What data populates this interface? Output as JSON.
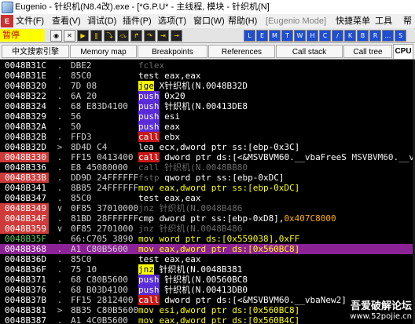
{
  "window": {
    "title": "Eugenio - 针织机(N8.4改).exe - [*G.P.U* - 主线程, 模块 - 针织机(N]"
  },
  "menubar": {
    "items": [
      {
        "label": "文件(F)",
        "enabled": true
      },
      {
        "label": "查看(V)",
        "enabled": true
      },
      {
        "label": "调试(D)",
        "enabled": true
      },
      {
        "label": "插件(P)",
        "enabled": true
      },
      {
        "label": "选项(T)",
        "enabled": true
      },
      {
        "label": "窗口(W)",
        "enabled": true
      },
      {
        "label": "帮助(H)",
        "enabled": true
      },
      {
        "label": "[Eugenio Mode]",
        "enabled": false
      },
      {
        "label": "快捷菜单",
        "enabled": true
      },
      {
        "label": "工具",
        "enabled": true
      },
      {
        "label": "帮",
        "enabled": true
      }
    ]
  },
  "toolbar": {
    "state_label": "暂停",
    "letter_buttons": [
      "L",
      "E",
      "M",
      "T",
      "W",
      "H",
      "C",
      "/",
      "K",
      "B",
      "R",
      "...",
      "S"
    ]
  },
  "tabs": [
    {
      "label": "中文搜索引擎",
      "active": false
    },
    {
      "label": "Memory map",
      "active": false
    },
    {
      "label": "Breakpoints",
      "active": false
    },
    {
      "label": "References",
      "active": false
    },
    {
      "label": "Call stack",
      "active": false
    },
    {
      "label": "Call tree",
      "active": false
    },
    {
      "label": "CPU",
      "active": true
    }
  ],
  "disasm": {
    "rows": [
      {
        "addr": "0048B31C",
        "gut": ".",
        "bytes": "DBE2",
        "ins": [
          {
            "t": "fclex",
            "c": "c-d"
          }
        ]
      },
      {
        "addr": "0048B31E",
        "gut": ".",
        "bytes": "85C0",
        "ins": [
          {
            "t": "test eax,eax",
            "c": "c-w"
          }
        ]
      },
      {
        "addr": "0048B320",
        "gut": ".",
        "bytes": "7D 08",
        "ins": [
          {
            "t": "jge",
            "c": "bg-jmp"
          },
          {
            "t": " X针织机(N.0048B32D",
            "c": "c-w"
          }
        ]
      },
      {
        "addr": "0048B322",
        "gut": ".",
        "bytes": "6A 20",
        "ins": [
          {
            "t": "push",
            "c": "bg-push"
          },
          {
            "t": " 0x20",
            "c": "c-w"
          }
        ]
      },
      {
        "addr": "0048B324",
        "gut": ".",
        "bytes": "68 E83D4100",
        "ins": [
          {
            "t": "push",
            "c": "bg-push"
          },
          {
            "t": " 针织机(N.00413DE8",
            "c": "c-w"
          }
        ]
      },
      {
        "addr": "0048B329",
        "gut": ".",
        "bytes": "56",
        "ins": [
          {
            "t": "push",
            "c": "bg-push"
          },
          {
            "t": " esi",
            "c": "c-w"
          }
        ]
      },
      {
        "addr": "0048B32A",
        "gut": ".",
        "bytes": "50",
        "ins": [
          {
            "t": "push",
            "c": "bg-push"
          },
          {
            "t": " eax",
            "c": "c-w"
          }
        ]
      },
      {
        "addr": "0048B32B",
        "gut": ".",
        "bytes": "FFD3",
        "ins": [
          {
            "t": "call",
            "c": "bg-call"
          },
          {
            "t": " ebx",
            "c": "c-w"
          }
        ]
      },
      {
        "addr": "0048B32D",
        "gut": ">",
        "bytes": "8D4D C4",
        "ins": [
          {
            "t": "lea ecx,dword ptr ss:[ebp-0x3C]",
            "c": "c-w"
          }
        ]
      },
      {
        "addr": "0048B330",
        "gut": ".",
        "bytes": "FF15 0413400",
        "hl": true,
        "ins": [
          {
            "t": "call",
            "c": "bg-call"
          },
          {
            "t": " dword ptr ds:[<&MSVBVM60.__vbaFreeS",
            "c": "c-w"
          },
          {
            "t": "  MSVBVM60.__v",
            "c": "c-m"
          }
        ]
      },
      {
        "addr": "0048B336",
        "gut": ".",
        "bytes": "E8 45080000",
        "ins": [
          {
            "t": "call 针织机(N.0048BB80",
            "c": "c-d"
          }
        ]
      },
      {
        "addr": "0048B33B",
        "gut": ".",
        "bytes": "DD9D 24FFFFFF",
        "hl": true,
        "ins": [
          {
            "t": "fstp",
            "c": "c-d"
          },
          {
            "t": " qword ptr ss:[ebp-0xDC]",
            "c": "c-w"
          }
        ]
      },
      {
        "addr": "0048B341",
        "gut": ".",
        "bytes": "8B85 24FFFFFF",
        "ins": [
          {
            "t": "mov eax,dword ptr ss:[ebp-0xDC]",
            "c": "c-y"
          }
        ]
      },
      {
        "addr": "0048B347",
        "gut": ".",
        "bytes": "85C0",
        "ins": [
          {
            "t": "test eax,eax",
            "c": "c-w"
          }
        ]
      },
      {
        "addr": "0048B349",
        "gut": "∨",
        "bytes": "0F85 37010000",
        "hl": true,
        "ins": [
          {
            "t": "jnz 针织机(N.0048B486",
            "c": "c-d"
          }
        ]
      },
      {
        "addr": "0048B34F",
        "gut": ".",
        "bytes": "81BD 28FFFFFF",
        "hl": true,
        "ins": [
          {
            "t": "cmp dword ptr ss:[ebp-0xD8],",
            "c": "c-w"
          },
          {
            "t": "0x407C8000",
            "c": "c-o"
          }
        ]
      },
      {
        "addr": "0048B359",
        "gut": "∨",
        "bytes": "0F85 2701000",
        "hl": true,
        "ins": [
          {
            "t": "jnz 针织机(N.0048B486",
            "c": "c-d"
          }
        ]
      },
      {
        "addr": "0048B35F",
        "gut": ".",
        "bytes": "66:C705 3890",
        "green": true,
        "ins": [
          {
            "t": "mov word ptr ds:[0x559038],0xFF",
            "c": "c-y"
          }
        ]
      },
      {
        "addr": "0048B368",
        "gut": ".",
        "bytes": "A1 C80B5600",
        "sel": true,
        "ins": [
          {
            "t": "mov eax,dword ptr ds:[0x560BC8]",
            "c": "c-y"
          }
        ]
      },
      {
        "addr": "0048B36D",
        "gut": ".",
        "bytes": "85C0",
        "ins": [
          {
            "t": "test eax,eax",
            "c": "c-w"
          }
        ]
      },
      {
        "addr": "0048B36F",
        "gut": ".",
        "bytes": "75 10",
        "ins": [
          {
            "t": "jnz",
            "c": "bg-jmp"
          },
          {
            "t": " 针织机(N.0048B381",
            "c": "c-w"
          }
        ]
      },
      {
        "addr": "0048B371",
        "gut": ".",
        "bytes": "68 C80B5600",
        "ins": [
          {
            "t": "push",
            "c": "bg-push"
          },
          {
            "t": " 针织机(N.00560BC8",
            "c": "c-w"
          }
        ]
      },
      {
        "addr": "0048B376",
        "gut": ".",
        "bytes": "68 B03D4100",
        "ins": [
          {
            "t": "push",
            "c": "bg-push"
          },
          {
            "t": " 针织机(N.00413DB0",
            "c": "c-w"
          }
        ]
      },
      {
        "addr": "0048B37B",
        "gut": ".",
        "bytes": "FF15 2812400",
        "ins": [
          {
            "t": "call",
            "c": "bg-call"
          },
          {
            "t": " dword ptr ds:[<&MSVBVM60.__vbaNew2]",
            "c": "c-w"
          }
        ]
      },
      {
        "addr": "0048B381",
        "gut": ">",
        "bytes": "8B35 C80B5600",
        "ins": [
          {
            "t": "mov esi,dword ptr ds:[0x560BC8]",
            "c": "c-y"
          }
        ]
      },
      {
        "addr": "0048B387",
        "gut": ".",
        "bytes": "A1 4C0B5600",
        "ins": [
          {
            "t": "mov eax,dword ptr ds:[0x560B4C]",
            "c": "c-y"
          }
        ]
      }
    ]
  },
  "watermark": {
    "line1": "吾爱破解论坛",
    "line2": "www.52pojie.cn"
  }
}
